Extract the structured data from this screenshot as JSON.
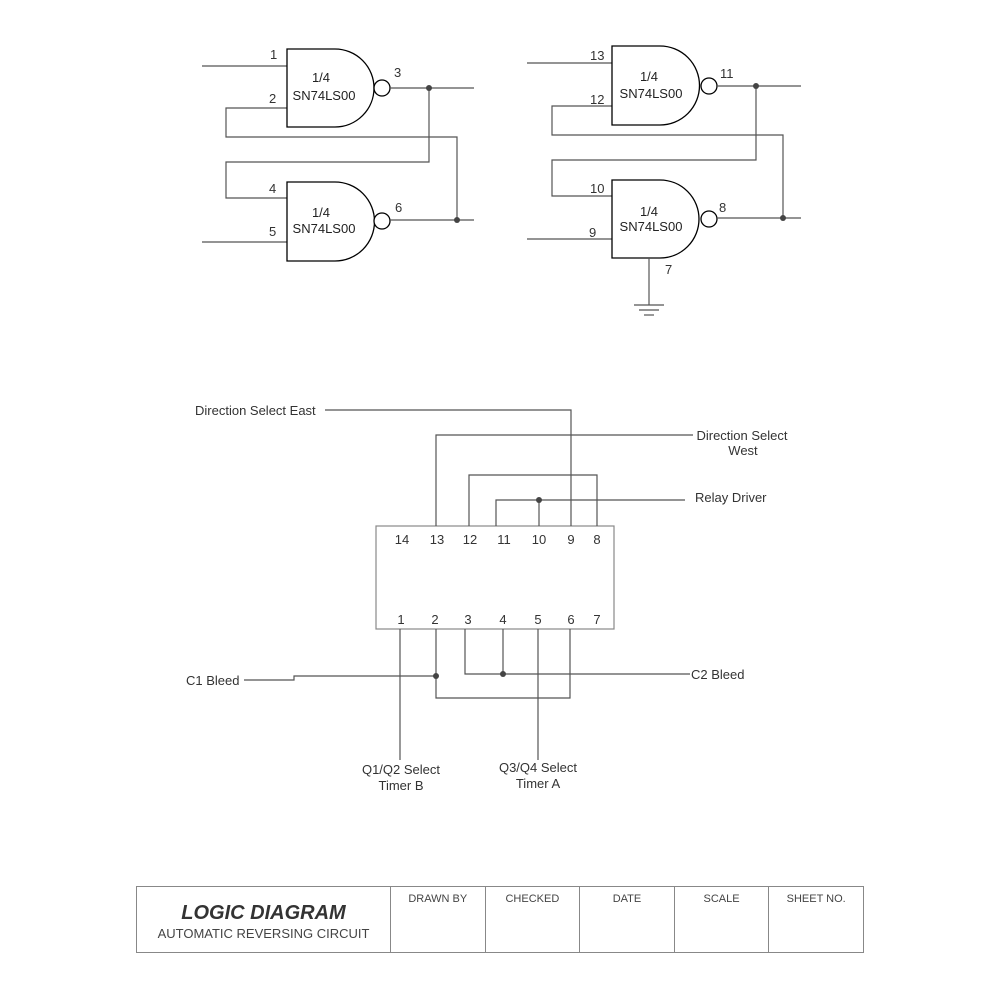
{
  "gates": [
    {
      "label_line1": "1/4",
      "label_line2": "SN74LS00",
      "pins": {
        "in_a": "1",
        "in_b": "2",
        "out": "3"
      }
    },
    {
      "label_line1": "1/4",
      "label_line2": "SN74LS00",
      "pins": {
        "in_a": "4",
        "in_b": "5",
        "out": "6"
      }
    },
    {
      "label_line1": "1/4",
      "label_line2": "SN74LS00",
      "pins": {
        "in_a": "13",
        "in_b": "12",
        "out": "11"
      }
    },
    {
      "label_line1": "1/4",
      "label_line2": "SN74LS00",
      "pins": {
        "in_a": "10",
        "in_b": "9",
        "out": "8",
        "gnd": "7"
      }
    }
  ],
  "ic": {
    "top_pins": [
      "14",
      "13",
      "12",
      "11",
      "10",
      "9",
      "8"
    ],
    "bottom_pins": [
      "1",
      "2",
      "3",
      "4",
      "5",
      "6",
      "7"
    ]
  },
  "signals": {
    "direction_east": "Direction Select East",
    "direction_west_line1": "Direction Select",
    "direction_west_line2": "West",
    "relay_driver": "Relay Driver",
    "c1_bleed": "C1 Bleed",
    "c2_bleed": "C2 Bleed",
    "q1q2_line1": "Q1/Q2 Select",
    "q1q2_line2": "Timer B",
    "q3q4_line1": "Q3/Q4 Select",
    "q3q4_line2": "Timer A"
  },
  "title_block": {
    "title": "LOGIC DIAGRAM",
    "subtitle": "AUTOMATIC REVERSING CIRCUIT",
    "drawn_by": "DRAWN BY",
    "checked": "CHECKED",
    "date": "DATE",
    "scale": "SCALE",
    "sheet_no": "SHEET NO."
  }
}
